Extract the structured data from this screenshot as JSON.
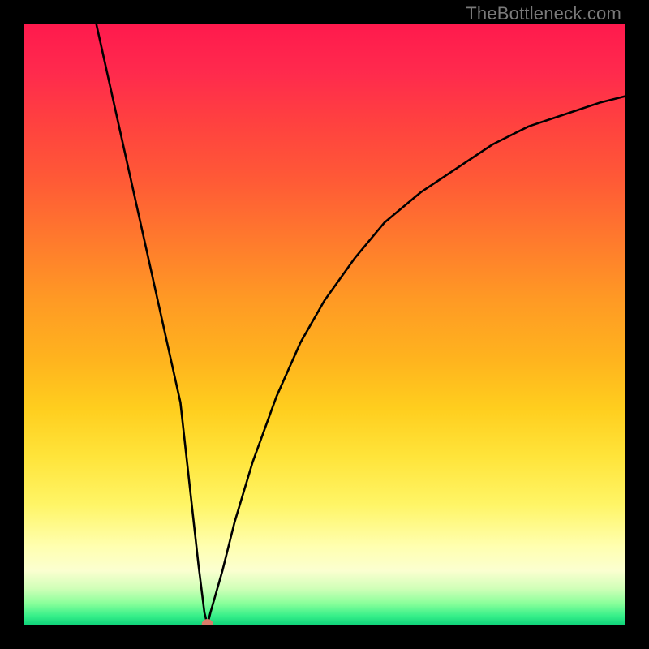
{
  "watermark": "TheBottleneck.com",
  "chart_data": {
    "type": "line",
    "title": "",
    "xlabel": "",
    "ylabel": "",
    "xlim": [
      0,
      100
    ],
    "ylim": [
      0,
      100
    ],
    "grid": false,
    "series": [
      {
        "name": "curve",
        "color": "#000000",
        "x": [
          12,
          14,
          16,
          18,
          20,
          22,
          24,
          26,
          27,
          28,
          29,
          30,
          30.5,
          31,
          33,
          35,
          38,
          42,
          46,
          50,
          55,
          60,
          66,
          72,
          78,
          84,
          90,
          96,
          100
        ],
        "y": [
          100,
          91,
          82,
          73,
          64,
          55,
          46,
          37,
          28,
          19,
          10,
          2,
          0,
          2,
          9,
          17,
          27,
          38,
          47,
          54,
          61,
          67,
          72,
          76,
          80,
          83,
          85,
          87,
          88
        ]
      }
    ],
    "points": [
      {
        "name": "marker",
        "x": 30.5,
        "y": 0,
        "color": "#d87c6a",
        "r": 7
      }
    ],
    "background_gradient": {
      "direction": "vertical",
      "stops": [
        {
          "pos": 0,
          "color": "#ff1a4d"
        },
        {
          "pos": 50,
          "color": "#ffb41e"
        },
        {
          "pos": 80,
          "color": "#fff566"
        },
        {
          "pos": 100,
          "color": "#10d47a"
        }
      ]
    }
  }
}
